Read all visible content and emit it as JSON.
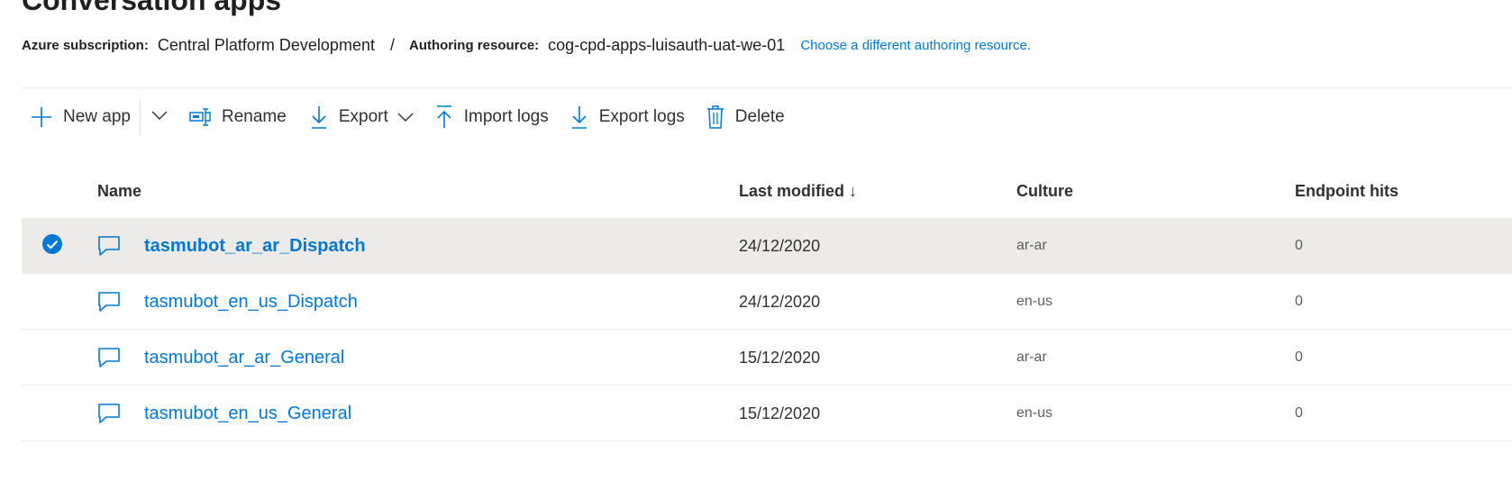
{
  "page": {
    "title": "Conversation apps"
  },
  "subscription": {
    "label": "Azure subscription:",
    "value": "Central Platform Development",
    "separator": "/",
    "resource_label": "Authoring resource:",
    "resource_value": "cog-cpd-apps-luisauth-uat-we-01",
    "change_link": "Choose a different authoring resource."
  },
  "toolbar": {
    "new_app": "New app",
    "rename": "Rename",
    "export": "Export",
    "import_logs": "Import logs",
    "export_logs": "Export logs",
    "delete": "Delete"
  },
  "table": {
    "columns": {
      "name": "Name",
      "last_modified": "Last modified ↓",
      "culture": "Culture",
      "endpoint_hits": "Endpoint hits"
    },
    "rows": [
      {
        "name": "tasmubot_ar_ar_Dispatch",
        "last_modified": "24/12/2020",
        "culture": "ar-ar",
        "endpoint_hits": "0",
        "selected": true
      },
      {
        "name": "tasmubot_en_us_Dispatch",
        "last_modified": "24/12/2020",
        "culture": "en-us",
        "endpoint_hits": "0",
        "selected": false
      },
      {
        "name": "tasmubot_ar_ar_General",
        "last_modified": "15/12/2020",
        "culture": "ar-ar",
        "endpoint_hits": "0",
        "selected": false
      },
      {
        "name": "tasmubot_en_us_General",
        "last_modified": "15/12/2020",
        "culture": "en-us",
        "endpoint_hits": "0",
        "selected": false
      }
    ]
  },
  "colors": {
    "accent": "#0078d4",
    "selected_row": "#edebe9",
    "text": "#323130"
  },
  "icons": {
    "new_app": "plus-icon",
    "rename": "rename-icon",
    "export": "download-icon",
    "import_logs": "upload-icon",
    "export_logs": "download-icon",
    "delete": "trash-icon",
    "row": "chat-icon",
    "selected": "check-circle-icon"
  }
}
